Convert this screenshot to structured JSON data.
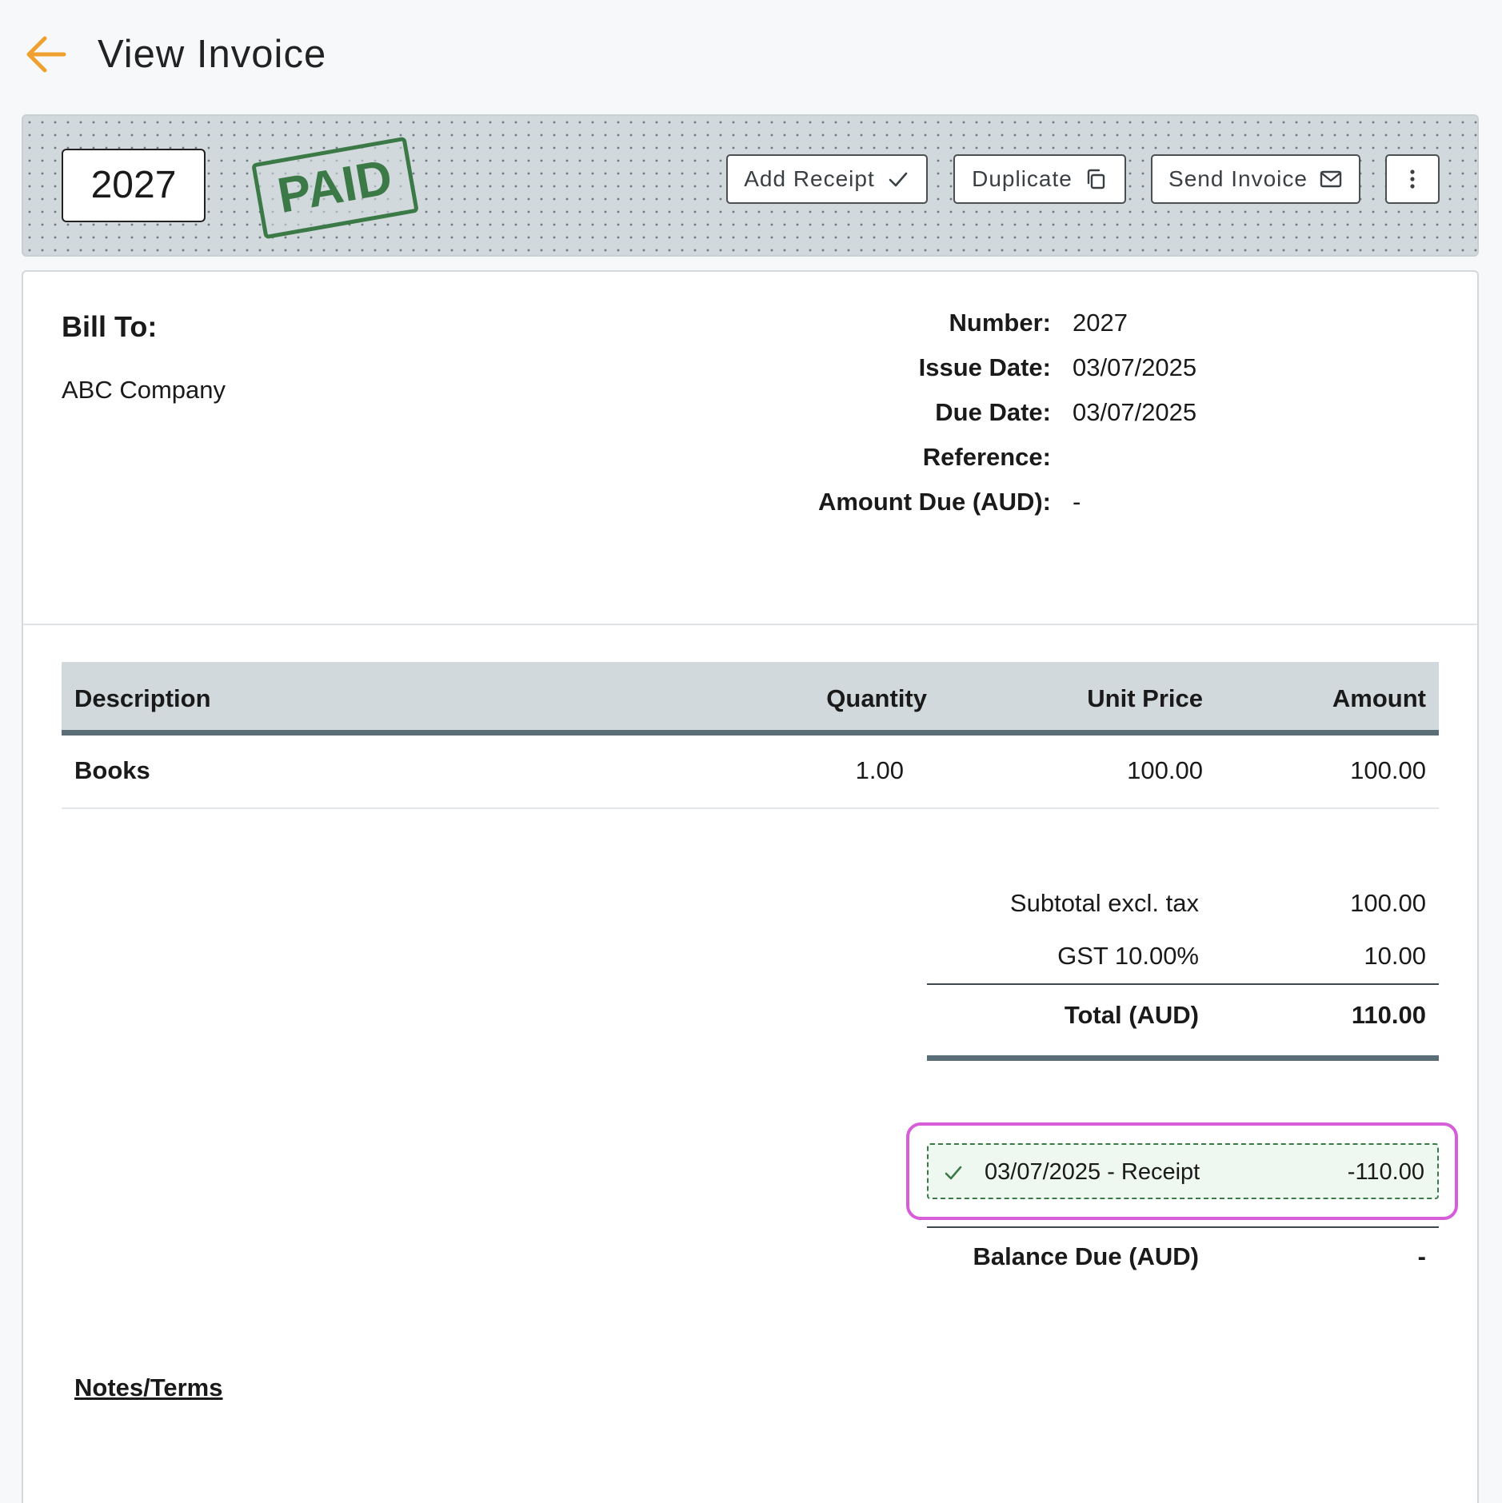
{
  "header": {
    "title": "View Invoice",
    "back_icon": "arrow-left-icon",
    "accent": "#f0a030"
  },
  "toolbar": {
    "invoice_number": "2027",
    "status_stamp": "PAID",
    "status_color": "#3b7a47",
    "buttons": {
      "add_receipt": "Add Receipt",
      "duplicate": "Duplicate",
      "send_invoice": "Send Invoice"
    },
    "more_icon": "vertical-dots-icon"
  },
  "bill_to": {
    "label": "Bill To:",
    "name": "ABC Company"
  },
  "meta": [
    {
      "label": "Number:",
      "value": "2027"
    },
    {
      "label": "Issue Date:",
      "value": "03/07/2025"
    },
    {
      "label": "Due Date:",
      "value": "03/07/2025"
    },
    {
      "label": "Reference:",
      "value": ""
    },
    {
      "label": "Amount Due (AUD):",
      "value": "-"
    }
  ],
  "items": {
    "columns": [
      "Description",
      "Quantity",
      "Unit Price",
      "Amount"
    ],
    "rows": [
      {
        "description": "Books",
        "quantity": "1.00",
        "unit_price": "100.00",
        "amount": "100.00"
      }
    ]
  },
  "totals": {
    "subtotal_label": "Subtotal excl. tax",
    "subtotal_value": "100.00",
    "gst_label": "GST 10.00%",
    "gst_value": "10.00",
    "total_label": "Total (AUD)",
    "total_value": "110.00"
  },
  "receipt": {
    "label": "03/07/2025 - Receipt",
    "amount": "-110.00",
    "highlight_color": "#d65ed8"
  },
  "balance": {
    "label": "Balance Due (AUD)",
    "value": "-"
  },
  "notes": {
    "title": "Notes/Terms"
  }
}
